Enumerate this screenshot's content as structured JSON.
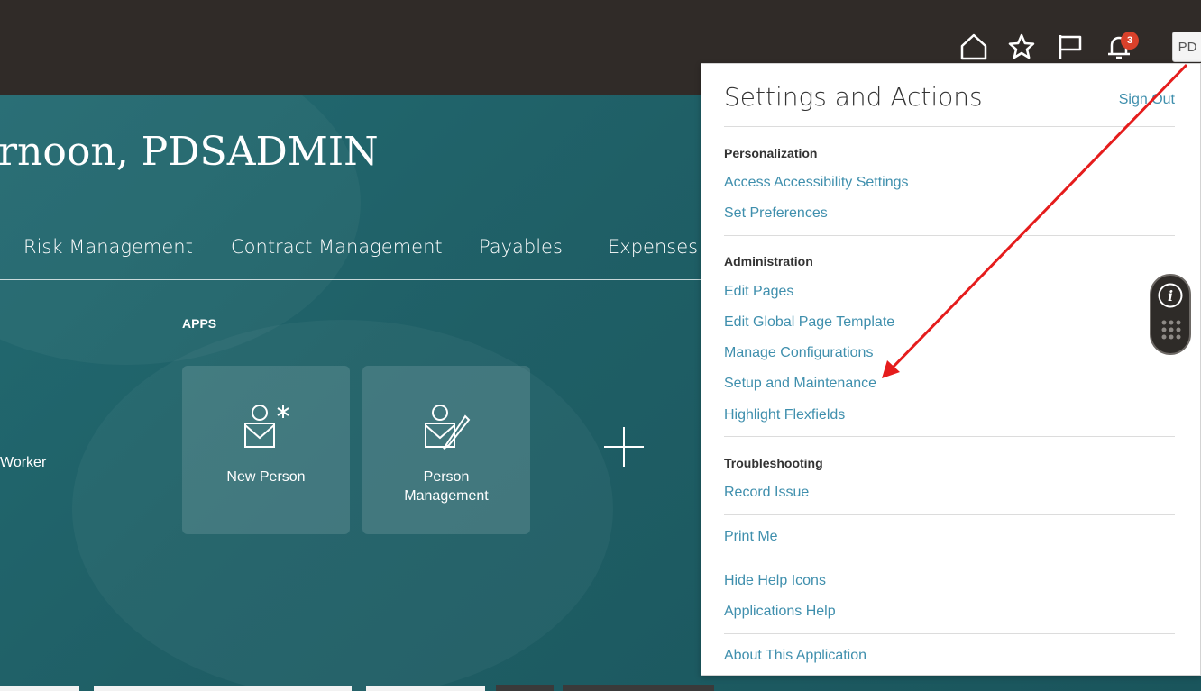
{
  "greeting": "rnoon, PDSADMIN",
  "nav_tabs": [
    {
      "label": "Risk Management"
    },
    {
      "label": "Contract Management"
    },
    {
      "label": "Payables"
    },
    {
      "label": "Expenses"
    }
  ],
  "apps_heading": "APPS",
  "worker_label": "Worker",
  "tiles": [
    {
      "label": "New Person",
      "icon": "new-person-icon"
    },
    {
      "label": "Person Management",
      "icon": "person-management-icon"
    }
  ],
  "add_tile_icon": "plus-icon",
  "top_icons": [
    "home-icon",
    "star-icon",
    "flag-icon",
    "bell-icon"
  ],
  "notification_count": "3",
  "avatar_initials": "PD",
  "settings_panel": {
    "title": "Settings and Actions",
    "sign_out": "Sign Out",
    "sections": {
      "personalization": {
        "heading": "Personalization",
        "links": [
          "Access Accessibility Settings",
          "Set Preferences"
        ]
      },
      "administration": {
        "heading": "Administration",
        "links": [
          "Edit Pages",
          "Edit Global Page Template",
          "Manage Configurations",
          "Setup and Maintenance",
          "Highlight Flexfields"
        ]
      },
      "troubleshooting": {
        "heading": "Troubleshooting",
        "links": [
          "Record Issue"
        ]
      }
    },
    "print_me": "Print Me",
    "help_links": [
      "Hide Help Icons",
      "Applications Help"
    ],
    "about": "About This Application"
  },
  "floating_controls": [
    "info-icon",
    "grid-icon"
  ],
  "colors": {
    "topbar": "#302b28",
    "content_bg": "#1e5d64",
    "link": "#3f8fad",
    "badge": "#d9412b",
    "annotation_arrow": "#e51c1c"
  }
}
